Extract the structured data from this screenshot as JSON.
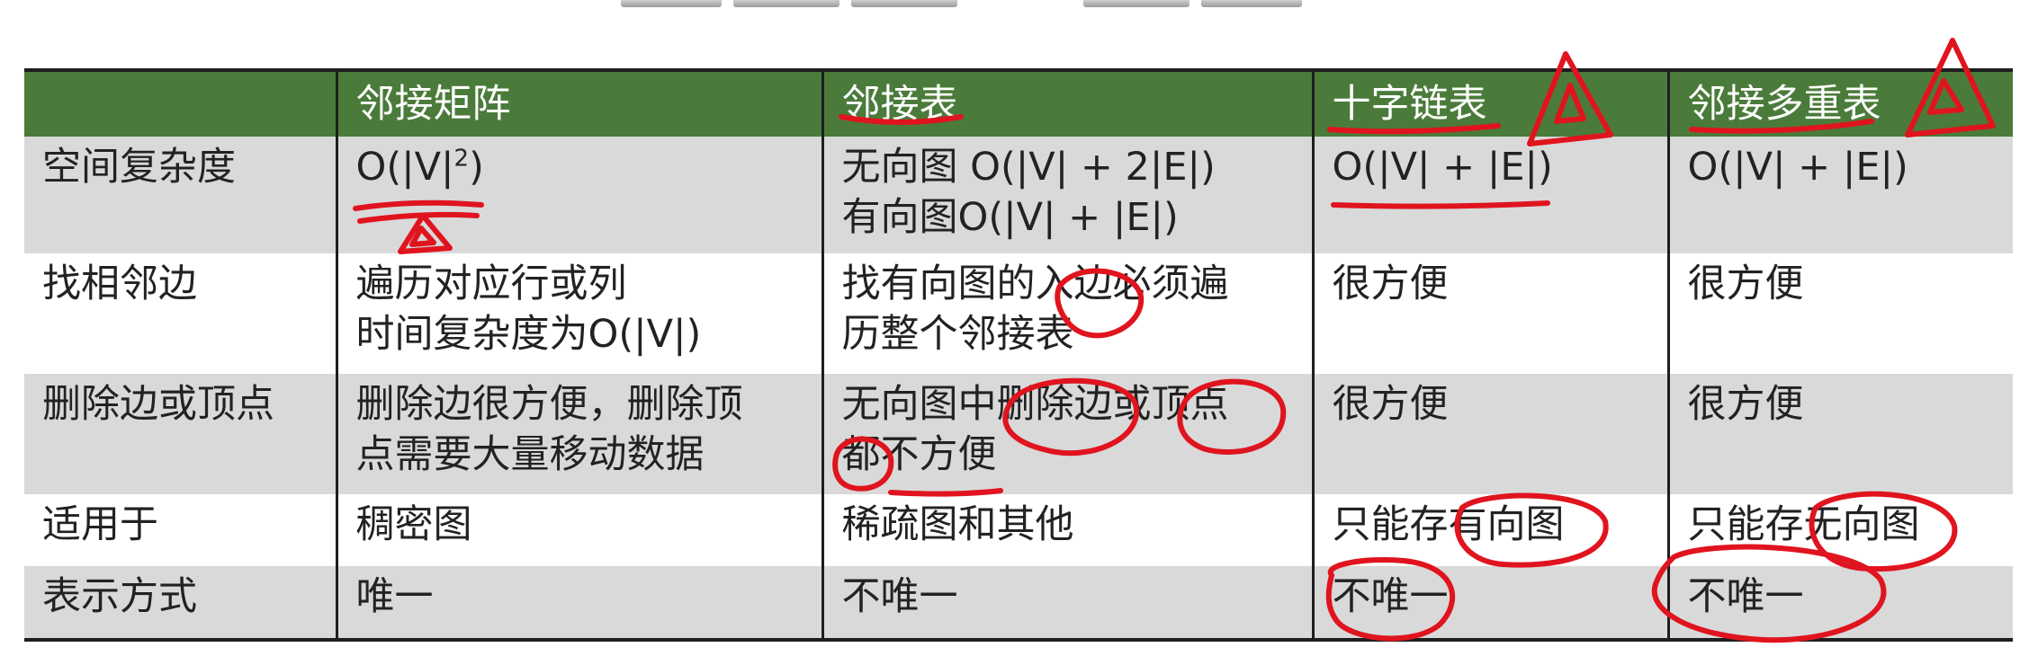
{
  "table": {
    "headers": [
      "",
      "邻接矩阵",
      "邻接表",
      "十字链表",
      "邻接多重表"
    ],
    "rows": [
      {
        "label": "空间复杂度",
        "cells": [
          {
            "lines": [
              "O(|V|"
            ],
            "sup": "2",
            "after": ")"
          },
          {
            "lines": [
              "无向图 O(|V| + 2|E|)",
              "有向图O(|V| + |E|)"
            ]
          },
          {
            "lines": [
              "O(|V| + |E|)"
            ]
          },
          {
            "lines": [
              "O(|V| + |E|)"
            ]
          }
        ]
      },
      {
        "label": "找相邻边",
        "cells": [
          {
            "lines": [
              "遍历对应行或列",
              "时间复杂度为O(|V|)"
            ]
          },
          {
            "lines": [
              "找有向图的入边必须遍",
              "历整个邻接表"
            ]
          },
          {
            "lines": [
              "很方便"
            ]
          },
          {
            "lines": [
              "很方便"
            ]
          }
        ]
      },
      {
        "label": "删除边或顶点",
        "cells": [
          {
            "lines": [
              "删除边很方便，删除顶",
              "点需要大量移动数据"
            ]
          },
          {
            "lines": [
              "无向图中删除边或顶点",
              "都不方便"
            ]
          },
          {
            "lines": [
              "很方便"
            ]
          },
          {
            "lines": [
              "很方便"
            ]
          }
        ]
      },
      {
        "label": "适用于",
        "cells": [
          {
            "lines": [
              "稠密图"
            ]
          },
          {
            "lines": [
              "稀疏图和其他"
            ]
          },
          {
            "lines": [
              "只能存有向图"
            ]
          },
          {
            "lines": [
              "只能存无向图"
            ]
          }
        ]
      },
      {
        "label": "表示方式",
        "cells": [
          {
            "lines": [
              "唯一"
            ]
          },
          {
            "lines": [
              "不唯一"
            ]
          },
          {
            "lines": [
              "不唯一"
            ]
          },
          {
            "lines": [
              "不唯一"
            ]
          }
        ]
      }
    ]
  },
  "colors": {
    "header_bg": "#4a7b3a",
    "row_gray": "#d9d9d9",
    "annotation_ink": "#e0141e"
  }
}
